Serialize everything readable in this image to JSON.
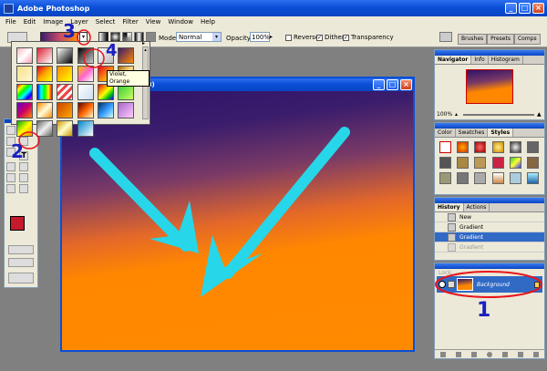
{
  "window": {
    "title": "Adobe Photoshop"
  },
  "menu": [
    "File",
    "Edit",
    "Image",
    "Layer",
    "Select",
    "Filter",
    "View",
    "Window",
    "Help"
  ],
  "options_bar": {
    "mode_label": "Mode:",
    "mode_value": "Normal",
    "opacity_label": "Opacity:",
    "opacity_value": "100%",
    "reverse_label": "Reverse",
    "dither_label": "Dither",
    "transparency_label": "Transparency",
    "dither_checked": true,
    "transparency_checked": true
  },
  "palette_well": {
    "tabs": [
      "Brushes",
      "Presets",
      "Comps"
    ]
  },
  "gradient_picker": {
    "tooltip": "Violet, Orange"
  },
  "document": {
    "title_suffix": "GB/8)"
  },
  "navigator": {
    "tabs": [
      "Navigator",
      "Info",
      "Histogram"
    ],
    "zoom": "100%"
  },
  "styles_panel": {
    "tabs": [
      "Color",
      "Swatches",
      "Styles"
    ]
  },
  "history_panel": {
    "tabs": [
      "History",
      "Actions"
    ],
    "items": [
      {
        "label": "New",
        "state": "normal"
      },
      {
        "label": "Gradient",
        "state": "normal"
      },
      {
        "label": "Gradient",
        "state": "selected"
      },
      {
        "label": "Gradient",
        "state": "dimmed"
      }
    ]
  },
  "layers_panel": {
    "lock_label": "Lock:",
    "layer_name": "Background"
  },
  "annotations": {
    "one": "1",
    "two": "2",
    "three": "3",
    "four": "4"
  },
  "colors": {
    "foreground": "#c41a2c",
    "gradient_start": "#3a1a6e",
    "gradient_end": "#ff8a00",
    "arrow": "#27d6e8",
    "annotation_red": "#e8141c",
    "annotation_blue": "#1a1fbf"
  }
}
